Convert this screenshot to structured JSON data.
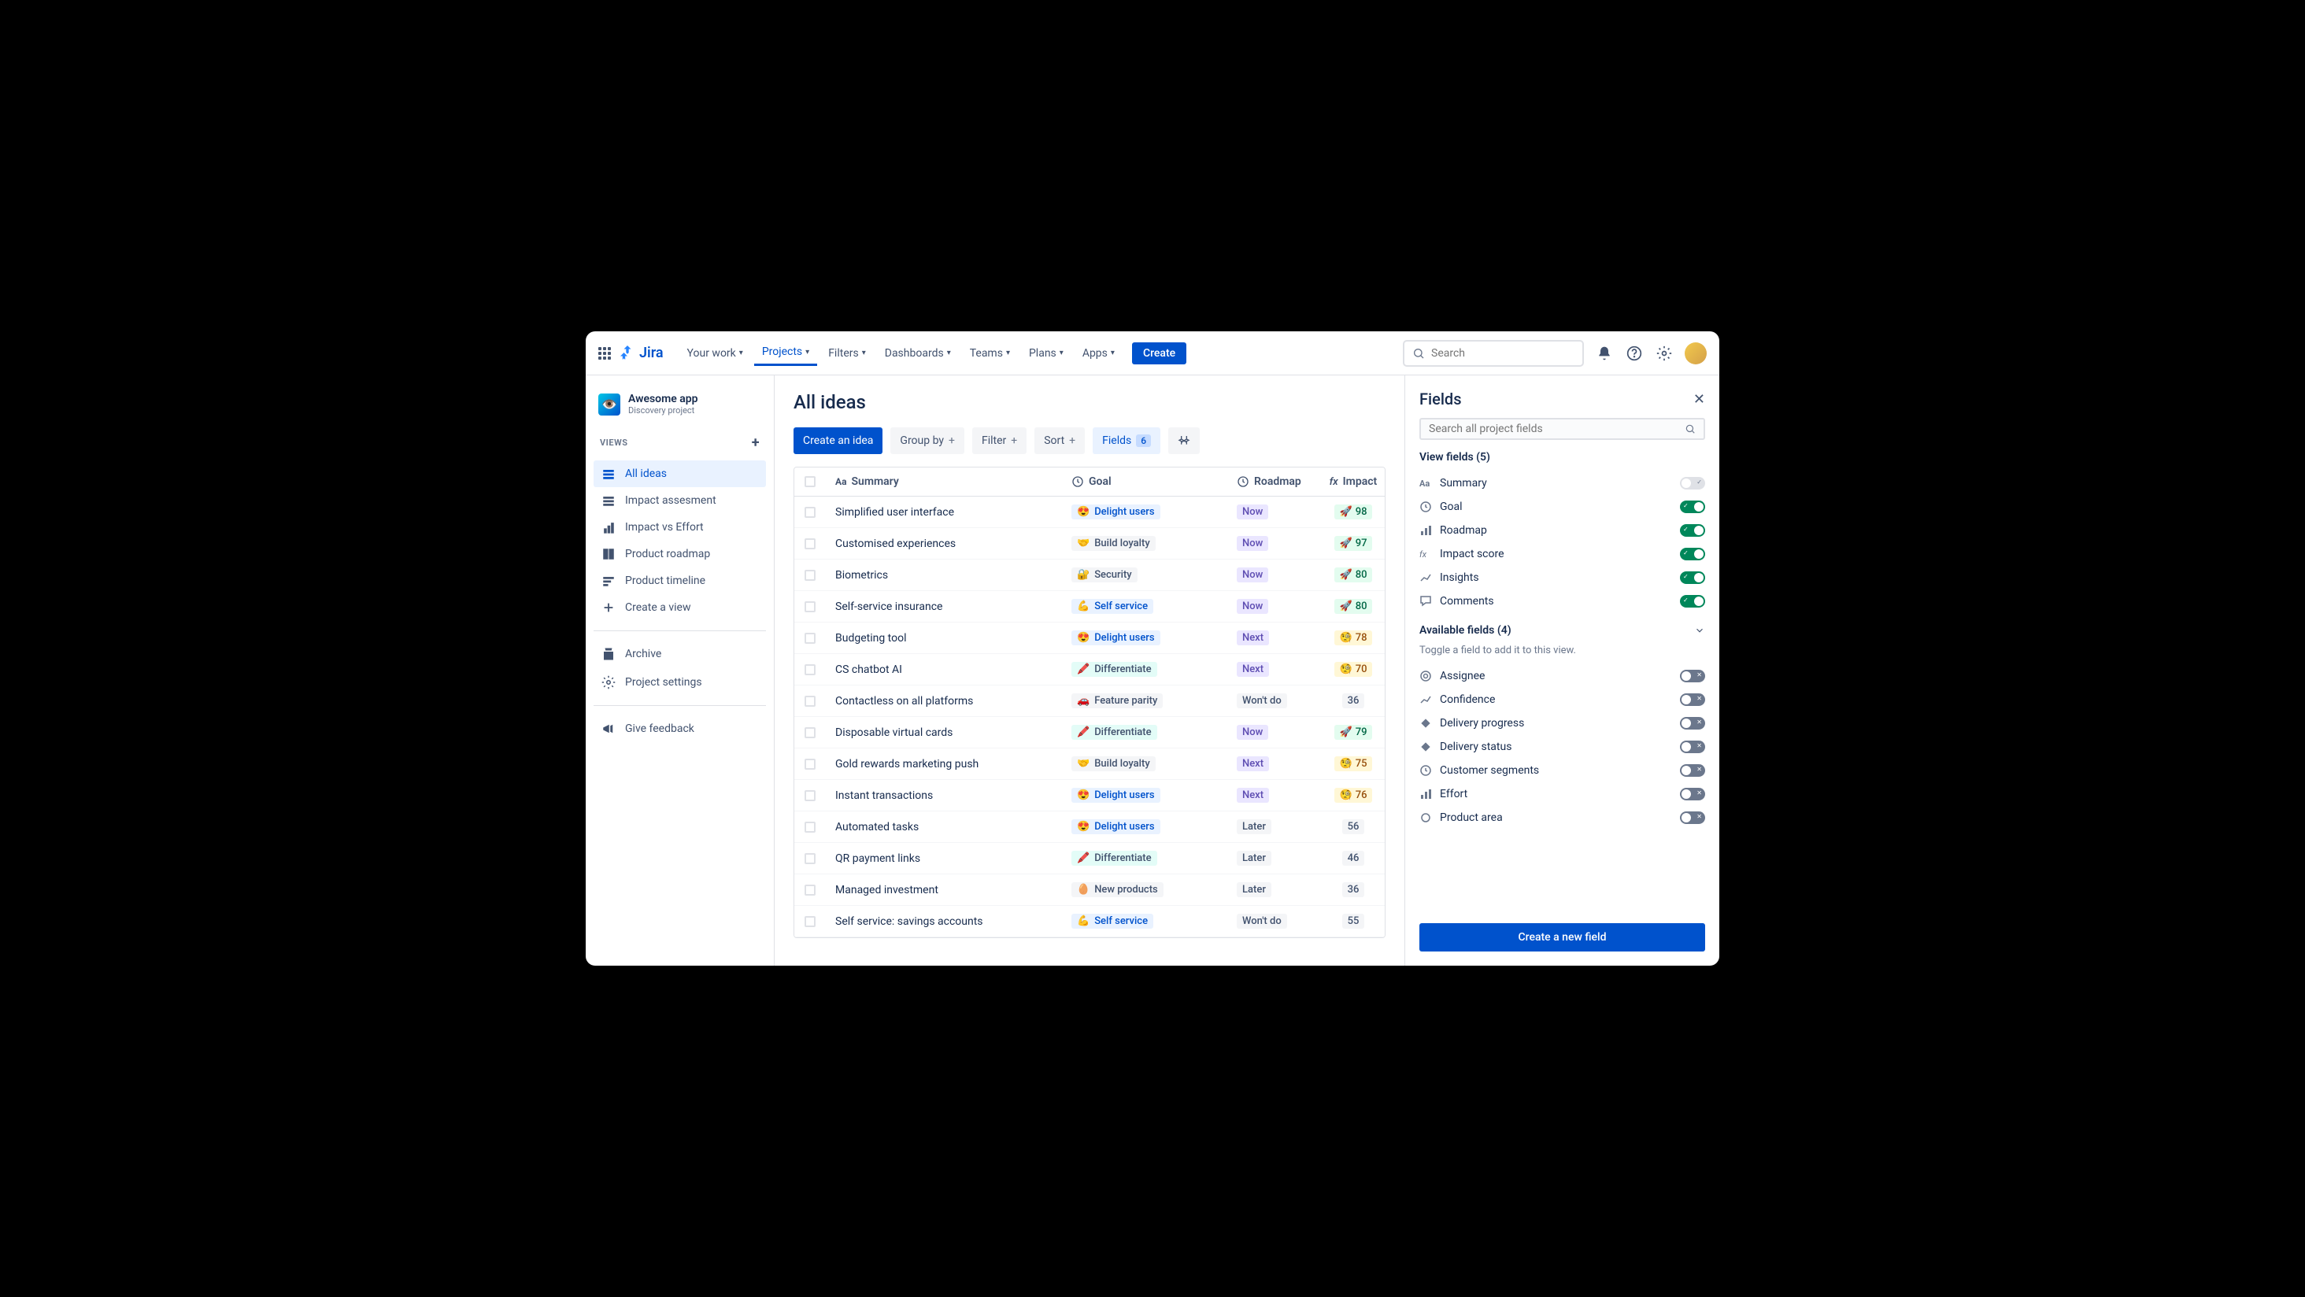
{
  "topbar": {
    "logo": "Jira",
    "nav": [
      "Your work",
      "Projects",
      "Filters",
      "Dashboards",
      "Teams",
      "Plans",
      "Apps"
    ],
    "active_nav_index": 1,
    "create": "Create",
    "search_placeholder": "Search"
  },
  "sidebar": {
    "project": {
      "name": "Awesome app",
      "subtitle": "Discovery project"
    },
    "section": "VIEWS",
    "views": [
      "All ideas",
      "Impact assesment",
      "Impact vs Effort",
      "Product roadmap",
      "Product timeline",
      "Create a view"
    ],
    "active_view_index": 0,
    "archive": "Archive",
    "settings": "Project settings",
    "feedback": "Give feedback"
  },
  "main": {
    "title": "All ideas",
    "toolbar": {
      "create": "Create an idea",
      "group_by": "Group by",
      "filter": "Filter",
      "sort": "Sort",
      "fields": "Fields",
      "fields_count": "6"
    },
    "columns": {
      "summary": "Summary",
      "goal": "Goal",
      "roadmap": "Roadmap",
      "impact": "Impact"
    },
    "rows": [
      {
        "summary": "Simplified user interface",
        "goal": {
          "e": "😍",
          "t": "Delight users",
          "c": "blue"
        },
        "rm": {
          "t": "Now",
          "c": "now"
        },
        "imp": {
          "e": "🚀",
          "v": "98",
          "c": "green"
        }
      },
      {
        "summary": "Customised experiences",
        "goal": {
          "e": "🤝",
          "t": "Build loyalty",
          "c": ""
        },
        "rm": {
          "t": "Now",
          "c": "now"
        },
        "imp": {
          "e": "🚀",
          "v": "97",
          "c": "green"
        }
      },
      {
        "summary": "Biometrics",
        "goal": {
          "e": "🔐",
          "t": "Security",
          "c": ""
        },
        "rm": {
          "t": "Now",
          "c": "now"
        },
        "imp": {
          "e": "🚀",
          "v": "80",
          "c": "green"
        }
      },
      {
        "summary": "Self-service insurance",
        "goal": {
          "e": "💪",
          "t": "Self service",
          "c": "blue"
        },
        "rm": {
          "t": "Now",
          "c": "now"
        },
        "imp": {
          "e": "🚀",
          "v": "80",
          "c": "green"
        }
      },
      {
        "summary": "Budgeting tool",
        "goal": {
          "e": "😍",
          "t": "Delight users",
          "c": "blue"
        },
        "rm": {
          "t": "Next",
          "c": "next"
        },
        "imp": {
          "e": "🧐",
          "v": "78",
          "c": "yellow"
        }
      },
      {
        "summary": "CS chatbot AI",
        "goal": {
          "e": "🖍️",
          "t": "Differentiate",
          "c": "teal"
        },
        "rm": {
          "t": "Next",
          "c": "next"
        },
        "imp": {
          "e": "🧐",
          "v": "70",
          "c": "yellow"
        }
      },
      {
        "summary": "Contactless on all platforms",
        "goal": {
          "e": "🚗",
          "t": "Feature parity",
          "c": ""
        },
        "rm": {
          "t": "Won't do",
          "c": "wont"
        },
        "imp": {
          "e": "",
          "v": "36",
          "c": "grey"
        }
      },
      {
        "summary": "Disposable virtual cards",
        "goal": {
          "e": "🖍️",
          "t": "Differentiate",
          "c": "teal"
        },
        "rm": {
          "t": "Now",
          "c": "now"
        },
        "imp": {
          "e": "🚀",
          "v": "79",
          "c": "green"
        }
      },
      {
        "summary": "Gold rewards marketing push",
        "goal": {
          "e": "🤝",
          "t": "Build loyalty",
          "c": ""
        },
        "rm": {
          "t": "Next",
          "c": "next"
        },
        "imp": {
          "e": "🧐",
          "v": "75",
          "c": "yellow"
        }
      },
      {
        "summary": "Instant transactions",
        "goal": {
          "e": "😍",
          "t": "Delight users",
          "c": "blue"
        },
        "rm": {
          "t": "Next",
          "c": "next"
        },
        "imp": {
          "e": "🧐",
          "v": "76",
          "c": "yellow"
        }
      },
      {
        "summary": "Automated tasks",
        "goal": {
          "e": "😍",
          "t": "Delight users",
          "c": "blue"
        },
        "rm": {
          "t": "Later",
          "c": "later"
        },
        "imp": {
          "e": "",
          "v": "56",
          "c": "grey"
        }
      },
      {
        "summary": "QR payment links",
        "goal": {
          "e": "🖍️",
          "t": "Differentiate",
          "c": "teal"
        },
        "rm": {
          "t": "Later",
          "c": "later"
        },
        "imp": {
          "e": "",
          "v": "46",
          "c": "grey"
        }
      },
      {
        "summary": "Managed investment",
        "goal": {
          "e": "🥚",
          "t": "New products",
          "c": ""
        },
        "rm": {
          "t": "Later",
          "c": "later"
        },
        "imp": {
          "e": "",
          "v": "36",
          "c": "grey"
        }
      },
      {
        "summary": "Self service: savings accounts",
        "goal": {
          "e": "💪",
          "t": "Self service",
          "c": "blue"
        },
        "rm": {
          "t": "Won't do",
          "c": "wont"
        },
        "imp": {
          "e": "",
          "v": "55",
          "c": "grey"
        }
      }
    ]
  },
  "panel": {
    "title": "Fields",
    "search_placeholder": "Search all project fields",
    "view_fields_label": "View fields (5)",
    "view_fields": [
      {
        "icon": "Aa",
        "label": "Summary",
        "locked": true
      },
      {
        "icon": "target",
        "label": "Goal",
        "on": true
      },
      {
        "icon": "bars",
        "label": "Roadmap",
        "on": true
      },
      {
        "icon": "fx",
        "label": "Impact score",
        "on": true
      },
      {
        "icon": "trend",
        "label": "Insights",
        "on": true
      },
      {
        "icon": "comment",
        "label": "Comments",
        "on": true
      }
    ],
    "available_fields_label": "Available fields (4)",
    "available_sub": "Toggle a field to add it to this view.",
    "available_fields": [
      {
        "icon": "at",
        "label": "Assignee"
      },
      {
        "icon": "trend",
        "label": "Confidence"
      },
      {
        "icon": "diamond",
        "label": "Delivery progress"
      },
      {
        "icon": "diamond",
        "label": "Delivery status"
      },
      {
        "icon": "clock",
        "label": "Customer segments"
      },
      {
        "icon": "bars",
        "label": "Effort"
      },
      {
        "icon": "circle",
        "label": "Product area"
      }
    ],
    "create": "Create a new field"
  }
}
